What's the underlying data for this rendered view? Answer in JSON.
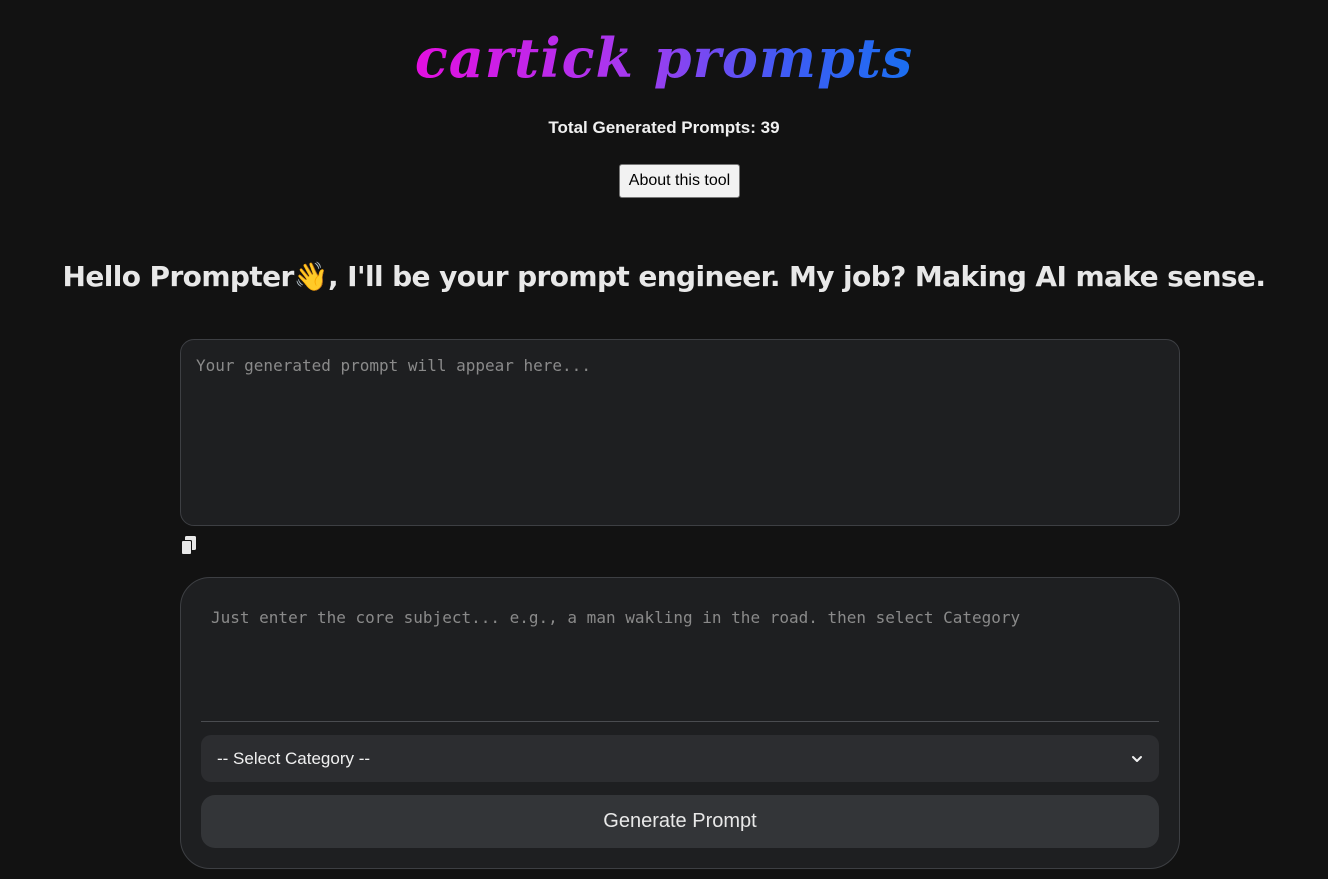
{
  "header": {
    "logo_text": "cartick prompts",
    "counter_text": "Total Generated Prompts: 39",
    "about_button_label": "About this tool"
  },
  "headline": {
    "text_before_icon": "Hello Prompter",
    "wave_emoji": "👋",
    "text_after_icon": ", I'll be your prompt engineer. My job? Making AI make sense."
  },
  "output": {
    "value": "",
    "placeholder": "Your generated prompt will appear here..."
  },
  "form": {
    "subject_value": "",
    "subject_placeholder": "Just enter the core subject... e.g., a man wakling in the road. then select Category",
    "category_selected": "-- Select Category --",
    "generate_label": "Generate Prompt"
  },
  "icons": {
    "copy": "copy-icon",
    "dropdown": "chevron-down-icon"
  },
  "colors": {
    "background": "#121212",
    "card": "#1e1f21",
    "logo_gradient_start": "#e40fe0",
    "logo_gradient_end": "#1a6ff0"
  }
}
